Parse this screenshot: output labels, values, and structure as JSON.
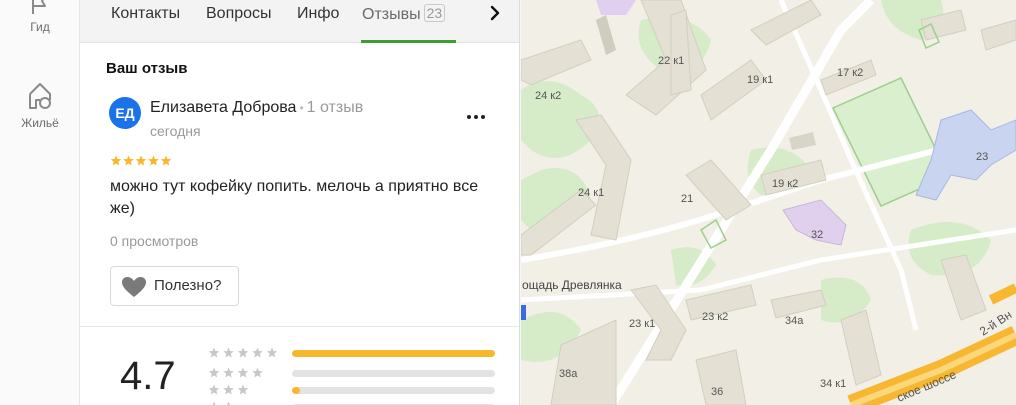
{
  "rail": {
    "guide_label": "Гид",
    "housing_label": "Жильё"
  },
  "tabs": {
    "contacts": "Контакты",
    "questions": "Вопросы",
    "info": "Инфо",
    "reviews": "Отзывы",
    "reviews_count": "23"
  },
  "review_section": {
    "title": "Ваш отзыв",
    "avatar_initials": "ЕД",
    "author_name": "Елизавета Доброва",
    "author_reviews": "1 отзыв",
    "date": "сегодня",
    "stars": 5,
    "text": "можно тут кофейку попить. мелочь а приятно все же)",
    "views": "0 просмотров",
    "useful_label": "Полезно?"
  },
  "rating_summary": {
    "average": "4.7",
    "distribution": [
      {
        "stars": 5,
        "fraction": 1.0
      },
      {
        "stars": 4,
        "fraction": 0.0
      },
      {
        "stars": 3,
        "fraction": 0.04
      },
      {
        "stars": 2,
        "fraction": 0.0
      }
    ]
  },
  "map": {
    "labels": {
      "b22k1": "22 к1",
      "b24k2": "24 к2",
      "b19k1": "19 к1",
      "b17k2": "17 к2",
      "b23": "23",
      "b24k1": "24 к1",
      "b21": "21",
      "b19k2": "19 к2",
      "b32": "32",
      "square": "ощадь Древлянка",
      "b23k1": "23 к1",
      "b23k2": "23 к2",
      "b34a": "34а",
      "b38a": "38а",
      "b36": "36",
      "b34k1": "34 к1",
      "road1": "ское шоссе",
      "road2": "2-й Вн"
    },
    "colors": {
      "background": "#f1efe6",
      "building": "#e4e0d4",
      "green": "#d6ecc9",
      "school": "#c8d4f0",
      "kindergarten": "#e0d0ee",
      "highway": "#f7b731"
    }
  },
  "colors": {
    "accent_green": "#3ba031",
    "star": "#f8b62a",
    "avatar": "#1a73e8"
  }
}
